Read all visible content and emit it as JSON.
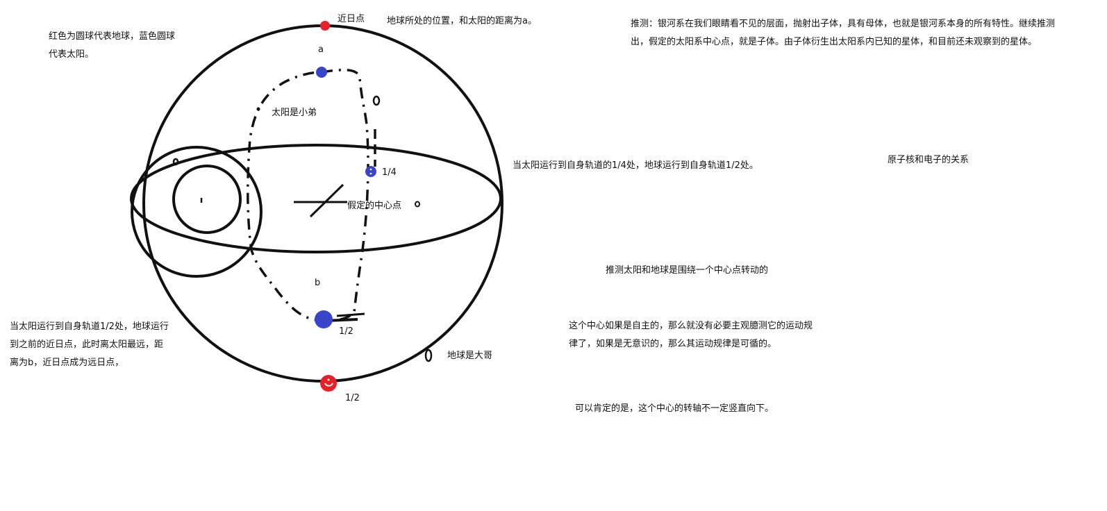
{
  "labels": {
    "perihelion": "近日点",
    "earth_position": "地球所处的位置，和太阳的距离为a。",
    "a": "a",
    "sun_little_brother": "太阳是小弟",
    "quarter": "1/4",
    "center_point": "假定的中心点",
    "b": "b",
    "half_bottom_sun": "1/2",
    "half_bottom_earth": "1/2",
    "earth_big_brother": "地球是大哥"
  },
  "notes": {
    "legend": "红色为圆球代表地球，蓝色圆球代表太阳。",
    "hypothesis": "推测：银河系在我们眼睛看不见的层面，抛射出子体，具有母体，也就是银河系本身的所有特性。继续推测出，假定的太阳系中心点，就是子体。由子体衍生出太阳系内已知的星体，和目前还未观察到的星体。",
    "quarter_orbit": "当太阳运行到自身轨道的1/4处，地球运行到自身轨道1/2处。",
    "atom_relation": "原子核和电子的关系",
    "center_rotation": "推测太阳和地球是围绕一个中心点转动的",
    "half_orbit": "当太阳运行到自身轨道1/2处，地球运行到之前的近日点，此时离太阳最远，距离为b，近日点成为远日点，",
    "autonomy": "这个中心如果是自主的，那么就没有必要主观臆测它的运动规律了，如果是无意识的，那么其运动规律是可循的。",
    "axis_note": "可以肯定的是，这个中心的转轴不一定竖直向下。"
  },
  "colors": {
    "earth": "#e8202a",
    "sun": "#3a44c8",
    "ink": "#111111"
  }
}
